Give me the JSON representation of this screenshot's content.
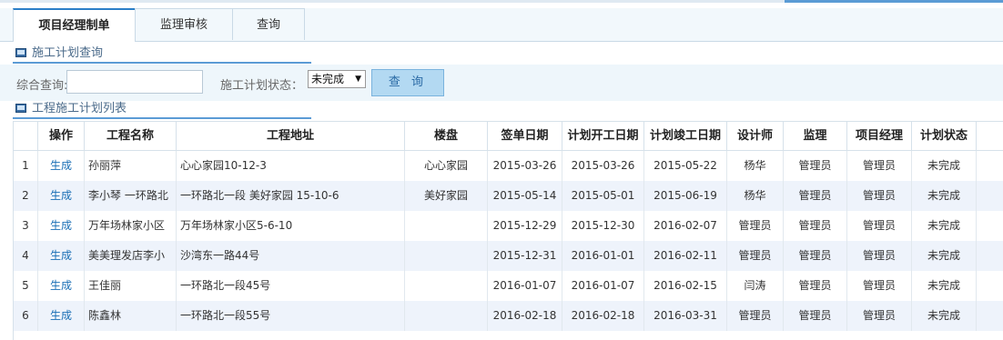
{
  "tabs": [
    "项目经理制单",
    "监理审核",
    "查询"
  ],
  "sections": {
    "query_title": "施工计划查询",
    "list_title": "工程施工计划列表"
  },
  "filter": {
    "keyword_label": "综合查询:",
    "keyword_value": "",
    "status_label": "施工计划状态：",
    "status_value": "未完成",
    "search_button": "查 询"
  },
  "table": {
    "headers": [
      "操作",
      "工程名称",
      "工程地址",
      "楼盘",
      "签单日期",
      "计划开工日期",
      "计划竣工日期",
      "设计师",
      "监理",
      "项目经理",
      "计划状态"
    ],
    "rows": [
      {
        "index": "1",
        "action": "生成",
        "name": "孙丽萍",
        "address": "心心家园10-12-3",
        "estate": "心心家园",
        "sign_date": "2015-03-26",
        "start_date": "2015-03-26",
        "end_date": "2015-05-22",
        "designer": "杨华",
        "supervisor": "管理员",
        "manager": "管理员",
        "status": "未完成"
      },
      {
        "index": "2",
        "action": "生成",
        "name": "李小琴 一环路北",
        "address": "一环路北一段 美好家园 15-10-6",
        "estate": "美好家园",
        "sign_date": "2015-05-14",
        "start_date": "2015-05-01",
        "end_date": "2015-06-19",
        "designer": "杨华",
        "supervisor": "管理员",
        "manager": "管理员",
        "status": "未完成"
      },
      {
        "index": "3",
        "action": "生成",
        "name": "万年场林家小区",
        "address": "万年场林家小区5-6-10",
        "estate": "",
        "sign_date": "2015-12-29",
        "start_date": "2015-12-30",
        "end_date": "2016-02-07",
        "designer": "管理员",
        "supervisor": "管理员",
        "manager": "管理员",
        "status": "未完成"
      },
      {
        "index": "4",
        "action": "生成",
        "name": "美美理发店李小",
        "address": "沙湾东一路44号",
        "estate": "",
        "sign_date": "2015-12-31",
        "start_date": "2016-01-01",
        "end_date": "2016-02-11",
        "designer": "管理员",
        "supervisor": "管理员",
        "manager": "管理员",
        "status": "未完成"
      },
      {
        "index": "5",
        "action": "生成",
        "name": "王佳丽",
        "address": "一环路北一段45号",
        "estate": "",
        "sign_date": "2016-01-07",
        "start_date": "2016-01-07",
        "end_date": "2016-02-15",
        "designer": "闫涛",
        "supervisor": "管理员",
        "manager": "管理员",
        "status": "未完成"
      },
      {
        "index": "6",
        "action": "生成",
        "name": "陈鑫林",
        "address": "一环路北一段55号",
        "estate": "",
        "sign_date": "2016-02-18",
        "start_date": "2016-02-18",
        "end_date": "2016-03-31",
        "designer": "管理员",
        "supervisor": "管理员",
        "manager": "管理员",
        "status": "未完成"
      }
    ]
  }
}
